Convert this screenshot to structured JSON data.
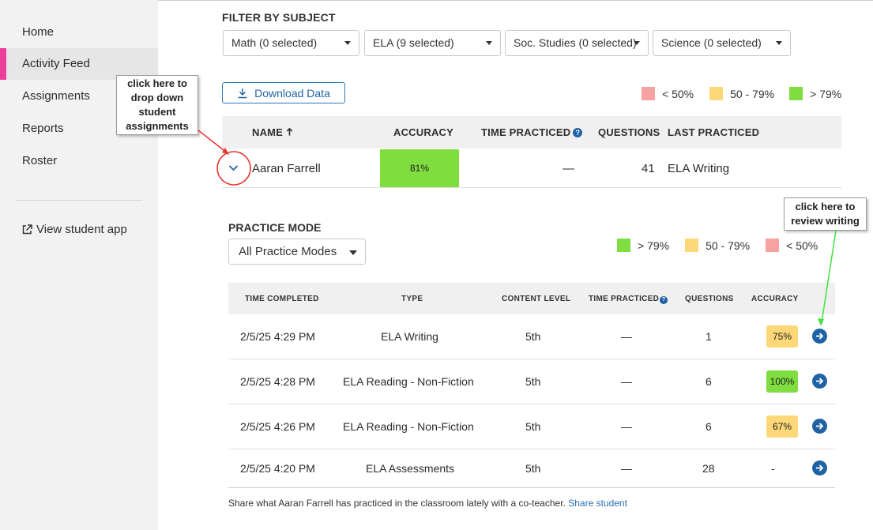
{
  "sidebar": {
    "items": [
      {
        "label": "Home"
      },
      {
        "label": "Activity Feed",
        "active": true
      },
      {
        "label": "Assignments"
      },
      {
        "label": "Reports"
      },
      {
        "label": "Roster"
      }
    ],
    "external_link": "View student app"
  },
  "filter": {
    "heading": "FILTER BY SUBJECT",
    "selects": [
      "Math (0 selected)",
      "ELA (9 selected)",
      "Soc. Studies (0 selected)",
      "Science (0 selected)"
    ]
  },
  "download_label": "Download Data",
  "legend_top": [
    {
      "label": "< 50%",
      "color": "#f7a1a1"
    },
    {
      "label": "50 - 79%",
      "color": "#fdd778"
    },
    {
      "label": "> 79%",
      "color": "#7fdd3f"
    }
  ],
  "student_table": {
    "headers": {
      "name": "NAME",
      "accuracy": "ACCURACY",
      "time": "TIME PRACTICED",
      "questions": "QUESTIONS",
      "last": "LAST PRACTICED"
    },
    "row": {
      "name": "Aaran Farrell",
      "accuracy": "81%",
      "time": "—",
      "questions": "41",
      "last": "ELA Writing"
    }
  },
  "practice": {
    "heading": "PRACTICE MODE",
    "select": "All Practice Modes",
    "legend": [
      {
        "label": "> 79%",
        "color": "#7fdd3f"
      },
      {
        "label": "50 - 79%",
        "color": "#fdd778"
      },
      {
        "label": "< 50%",
        "color": "#f7a1a1"
      }
    ],
    "headers": {
      "time_completed": "TIME COMPLETED",
      "type": "TYPE",
      "content_level": "CONTENT LEVEL",
      "time_practiced": "TIME PRACTICED",
      "questions": "QUESTIONS",
      "accuracy": "ACCURACY"
    },
    "rows": [
      {
        "time": "2/5/25 4:29 PM",
        "type": "ELA Writing",
        "level": "5th",
        "practiced": "—",
        "questions": "1",
        "accuracy": "75%",
        "color": "#fdd778"
      },
      {
        "time": "2/5/25 4:28 PM",
        "type": "ELA Reading - Non-Fiction",
        "level": "5th",
        "practiced": "—",
        "questions": "6",
        "accuracy": "100%",
        "color": "#7fdd3f"
      },
      {
        "time": "2/5/25 4:26 PM",
        "type": "ELA Reading - Non-Fiction",
        "level": "5th",
        "practiced": "—",
        "questions": "6",
        "accuracy": "67%",
        "color": "#fdd778"
      },
      {
        "time": "2/5/25 4:20 PM",
        "type": "ELA Assessments",
        "level": "5th",
        "practiced": "—",
        "questions": "28",
        "accuracy": "-",
        "color": ""
      }
    ],
    "footer_text": "Share what Aaran Farrell has practiced in the classroom lately with a co-teacher.",
    "footer_link": "Share student"
  },
  "annotations": {
    "left_callout": [
      "click here to",
      "drop down",
      "student",
      "assignments"
    ],
    "right_callout": [
      "click here to",
      "review writing"
    ]
  }
}
